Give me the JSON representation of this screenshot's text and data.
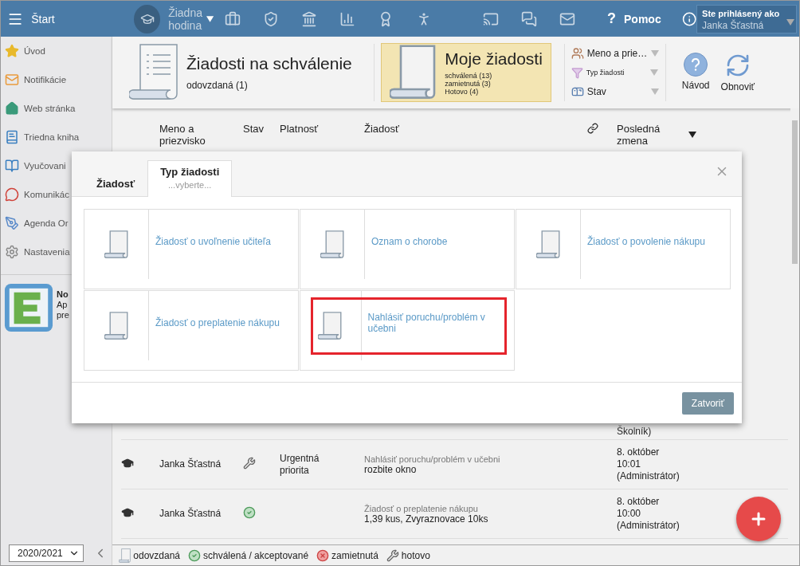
{
  "topbar": {
    "menu_label": "Štart",
    "lesson": "Žiadna hodina",
    "help_glyph": "?",
    "help_label": "Pomoc",
    "user_caption": "Ste prihlásený ako",
    "user_name": "Janka Šťastná"
  },
  "sidebar": {
    "items": [
      {
        "label": "Úvod",
        "kind": "star"
      },
      {
        "label": "Notifikácie",
        "kind": "mail"
      },
      {
        "label": "Web stránka",
        "kind": "home"
      },
      {
        "label": "Triedna kniha",
        "kind": "book"
      },
      {
        "label": "Vyučovani",
        "kind": "open-book"
      },
      {
        "label": "Komunikác",
        "kind": "chat"
      },
      {
        "label": "Agenda Or",
        "kind": "pen"
      },
      {
        "label": "Nastavenia",
        "kind": "gear"
      }
    ],
    "promo": {
      "title": "No",
      "line_1": "Ap",
      "line_2": "pre"
    },
    "year": "2020/2021"
  },
  "header": {
    "cards": [
      {
        "title": "Žiadosti na schválenie",
        "lines": [
          "odovzdaná (1)"
        ],
        "selected": false
      },
      {
        "title": "Moje žiadosti",
        "lines": [
          "schválená (13)",
          "zamietnutá (3)",
          "Hotovo (4)"
        ],
        "selected": true
      }
    ],
    "filters": [
      {
        "label": "Meno a prie…",
        "kind": "people",
        "small": false
      },
      {
        "label": "Typ žiadosti",
        "kind": "funnel",
        "small": true
      },
      {
        "label": "Stav",
        "kind": "mailbox",
        "small": false
      }
    ],
    "buttons": [
      {
        "label": "Návod",
        "kind": "help"
      },
      {
        "label": "Obnoviť",
        "kind": "refresh"
      }
    ]
  },
  "table": {
    "columns": [
      "Meno a priezvisko",
      "Stav",
      "Platnosť",
      "Žiadosť",
      "Posledná zmena"
    ],
    "rows": [
      {
        "name": "",
        "validity": "",
        "request_type": "",
        "request_text": "",
        "last_change": "Školník)"
      },
      {
        "name": "Janka Šťastná",
        "kind": "done",
        "validity": "Urgentná priorita",
        "request_type": "Nahlásiť poruchu/problém v učebni",
        "request_text": "rozbite okno",
        "last_change": "8. október 10:01 (Administrátor)"
      },
      {
        "name": "Janka Šťastná",
        "kind": "approved",
        "validity": "",
        "request_type": "Žiadosť o preplatenie nákupu",
        "request_text": "1,39 kus, Zvyraznovace 10ks",
        "last_change": "8. október 10:00 (Administrátor)"
      }
    ]
  },
  "legend": [
    {
      "label": "odovzdaná",
      "kind": "submitted"
    },
    {
      "label": "schválená / akceptované",
      "kind": "approved"
    },
    {
      "label": "zamietnutá",
      "kind": "rejected"
    },
    {
      "label": "hotovo",
      "kind": "done"
    }
  ],
  "dialog": {
    "tabs": [
      {
        "label": "Žiadosť",
        "selected": false
      },
      {
        "label": "Typ žiadosti",
        "hint": "...vyberte...",
        "selected": true
      }
    ],
    "types": [
      {
        "label": "Žiadosť o uvoľnenie učiteľa",
        "highlighted": false
      },
      {
        "label": "Oznam o chorobe",
        "highlighted": false
      },
      {
        "label": "Žiadosť o povolenie nákupu",
        "highlighted": false
      },
      {
        "label": "Žiadosť o preplatenie nákupu",
        "highlighted": false
      },
      {
        "label": "Nahlásiť poruchu/problém v učebni",
        "highlighted": true
      }
    ],
    "close_button": "Zatvoriť"
  }
}
